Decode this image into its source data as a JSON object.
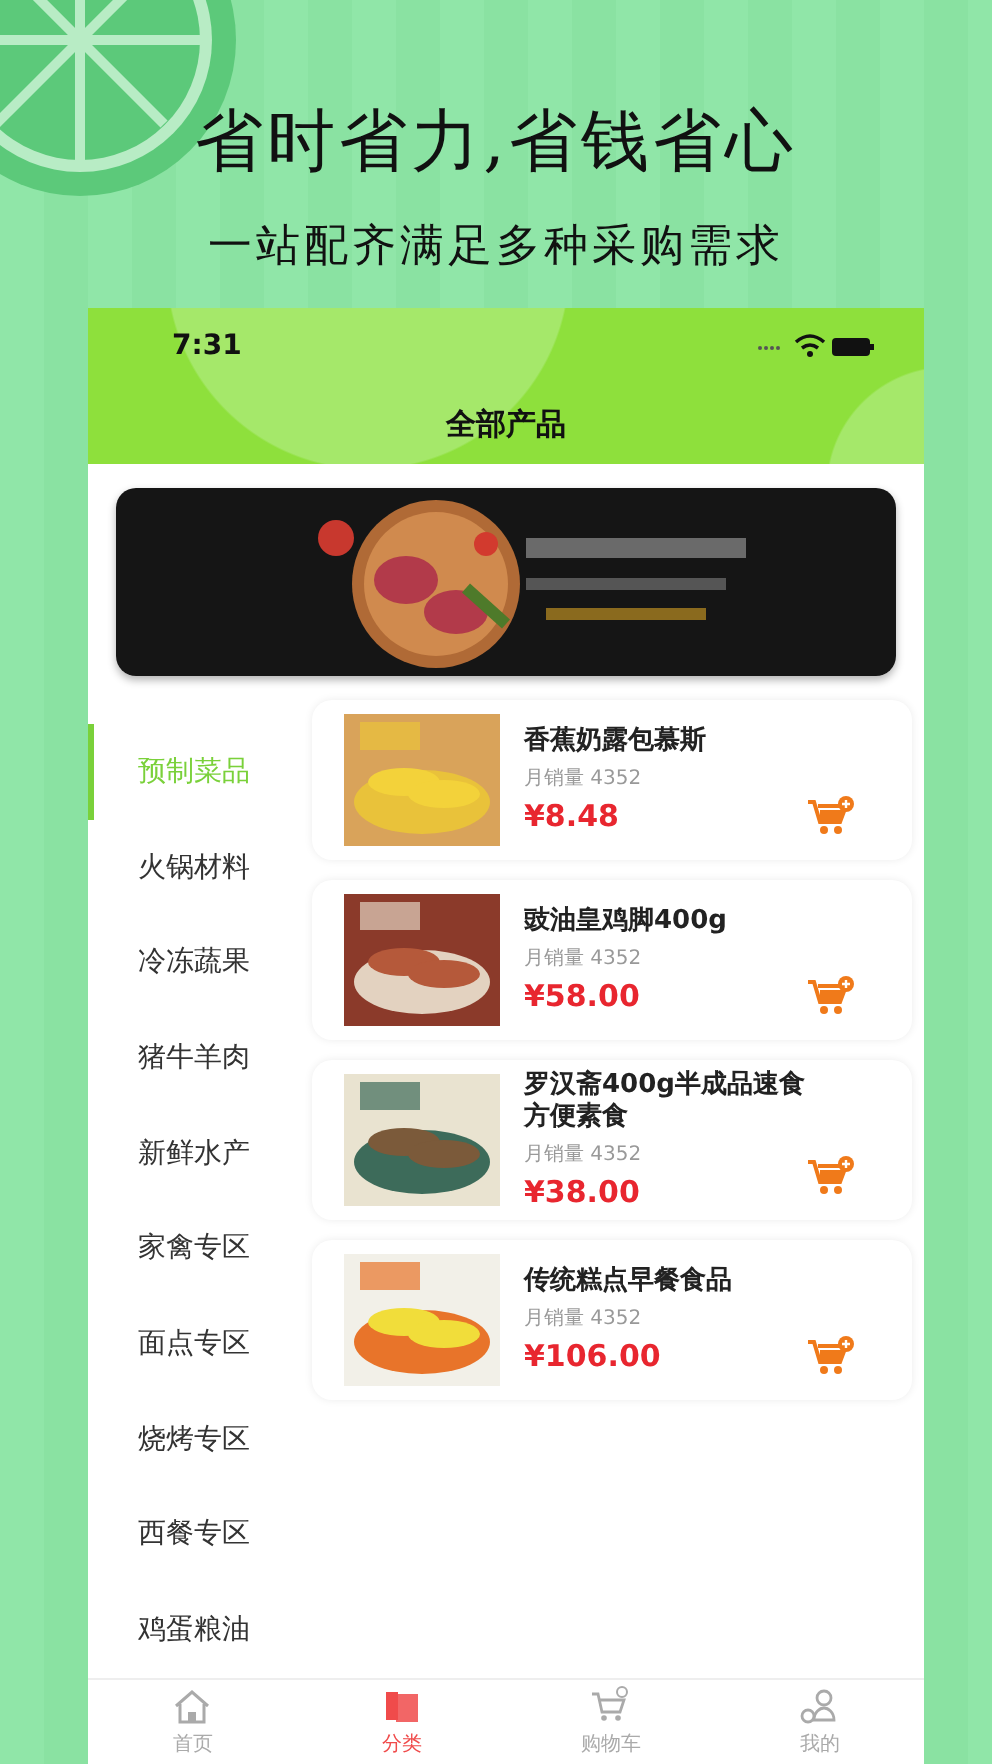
{
  "headline": "省时省力,省钱省心",
  "subheadline": "一站配齐满足多种采购需求",
  "status_bar": {
    "time": "7:31"
  },
  "title": "全部产品",
  "categories": [
    {
      "label": "预制菜品",
      "selected": true
    },
    {
      "label": "火锅材料",
      "selected": false
    },
    {
      "label": "冷冻蔬果",
      "selected": false
    },
    {
      "label": "猪牛羊肉",
      "selected": false
    },
    {
      "label": "新鲜水产",
      "selected": false
    },
    {
      "label": "家禽专区",
      "selected": false
    },
    {
      "label": "面点专区",
      "selected": false
    },
    {
      "label": "烧烤专区",
      "selected": false
    },
    {
      "label": "西餐专区",
      "selected": false
    },
    {
      "label": "鸡蛋粮油",
      "selected": false
    }
  ],
  "products": [
    {
      "name": "香蕉奶露包慕斯",
      "sales": "月销量 4352",
      "price": "¥8.48"
    },
    {
      "name": "豉油皇鸡脚400g",
      "sales": "月销量 4352",
      "price": "¥58.00"
    },
    {
      "name": "罗汉斋400g半成品速食方便素食",
      "sales": "月销量 4352",
      "price": "¥38.00"
    },
    {
      "name": "传统糕点早餐食品",
      "sales": "月销量 4352",
      "price": "¥106.00"
    }
  ],
  "tab_bar": [
    {
      "label": "首页",
      "kind": "home",
      "selected": false
    },
    {
      "label": "分类",
      "kind": "category",
      "selected": true
    },
    {
      "label": "购物车",
      "kind": "cart",
      "selected": false
    },
    {
      "label": "我的",
      "kind": "user",
      "selected": false
    }
  ]
}
